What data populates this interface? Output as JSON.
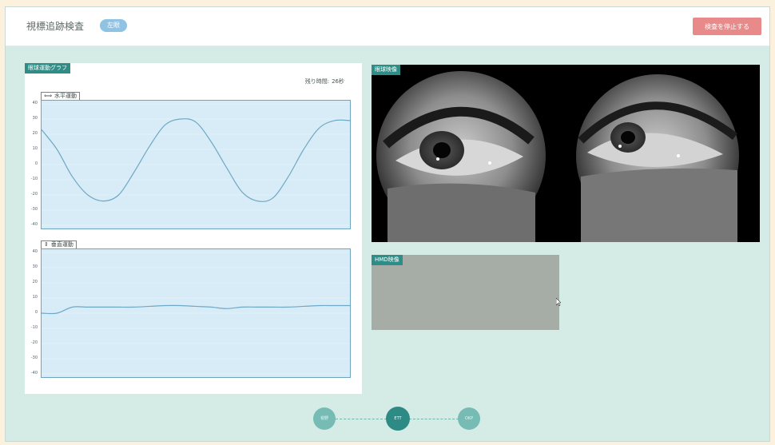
{
  "header": {
    "title": "視標追跡検査",
    "badge": "左眼",
    "stop_button": "検査を停止する"
  },
  "graph_panel": {
    "tag": "眼球運動グラフ",
    "remaining_label": "残り時間:",
    "remaining_value": "26秒",
    "horizontal": {
      "label": "水平運動",
      "arrow": "⟺",
      "ylim": [
        -40,
        40
      ],
      "yticks": [
        "40",
        "30",
        "20",
        "10",
        "0",
        "-10",
        "-20",
        "-30",
        "-40"
      ]
    },
    "vertical": {
      "label": "垂直運動",
      "arrow": "⇕",
      "ylim": [
        -40,
        40
      ],
      "yticks": [
        "40",
        "30",
        "20",
        "10",
        "0",
        "-10",
        "-20",
        "-30",
        "-40"
      ]
    }
  },
  "eye_panel": {
    "tag": "眼球映像"
  },
  "hmd_panel": {
    "tag": "HMD映像"
  },
  "stepper": {
    "steps": [
      {
        "label": "視野",
        "active": false
      },
      {
        "label": "ETT",
        "active": true
      },
      {
        "label": "OKP",
        "active": false
      }
    ]
  },
  "chart_data": [
    {
      "type": "line",
      "ylabel": "",
      "ylim": [
        -40,
        40
      ],
      "series": [
        {
          "x": [
            0,
            1,
            2,
            3,
            4,
            5,
            6,
            7,
            8,
            9,
            10,
            11,
            12,
            13,
            14,
            15,
            16,
            17,
            18,
            19,
            20
          ],
          "values": [
            23,
            10,
            -8,
            -20,
            -24,
            -20,
            -5,
            12,
            26,
            30,
            28,
            15,
            -2,
            -18,
            -24,
            -22,
            -8,
            10,
            24,
            29,
            29
          ]
        }
      ]
    },
    {
      "type": "line",
      "ylabel": "",
      "ylim": [
        -40,
        40
      ],
      "series": [
        {
          "x": [
            0,
            1,
            2,
            3,
            4,
            5,
            6,
            7,
            8,
            9,
            10,
            11,
            12,
            13,
            14,
            15,
            16,
            17,
            18,
            19,
            20
          ],
          "values": [
            0,
            0,
            4,
            4,
            4,
            4,
            4,
            4.5,
            5,
            5,
            4.5,
            4,
            3,
            4,
            4,
            4,
            4,
            4.5,
            5,
            5,
            5
          ]
        }
      ]
    }
  ],
  "colors": {
    "accent": "#2f8d87",
    "stop_button": "#e98a8a",
    "plot_bg": "#d8ecf7",
    "plot_line": "#6fa8c6"
  }
}
